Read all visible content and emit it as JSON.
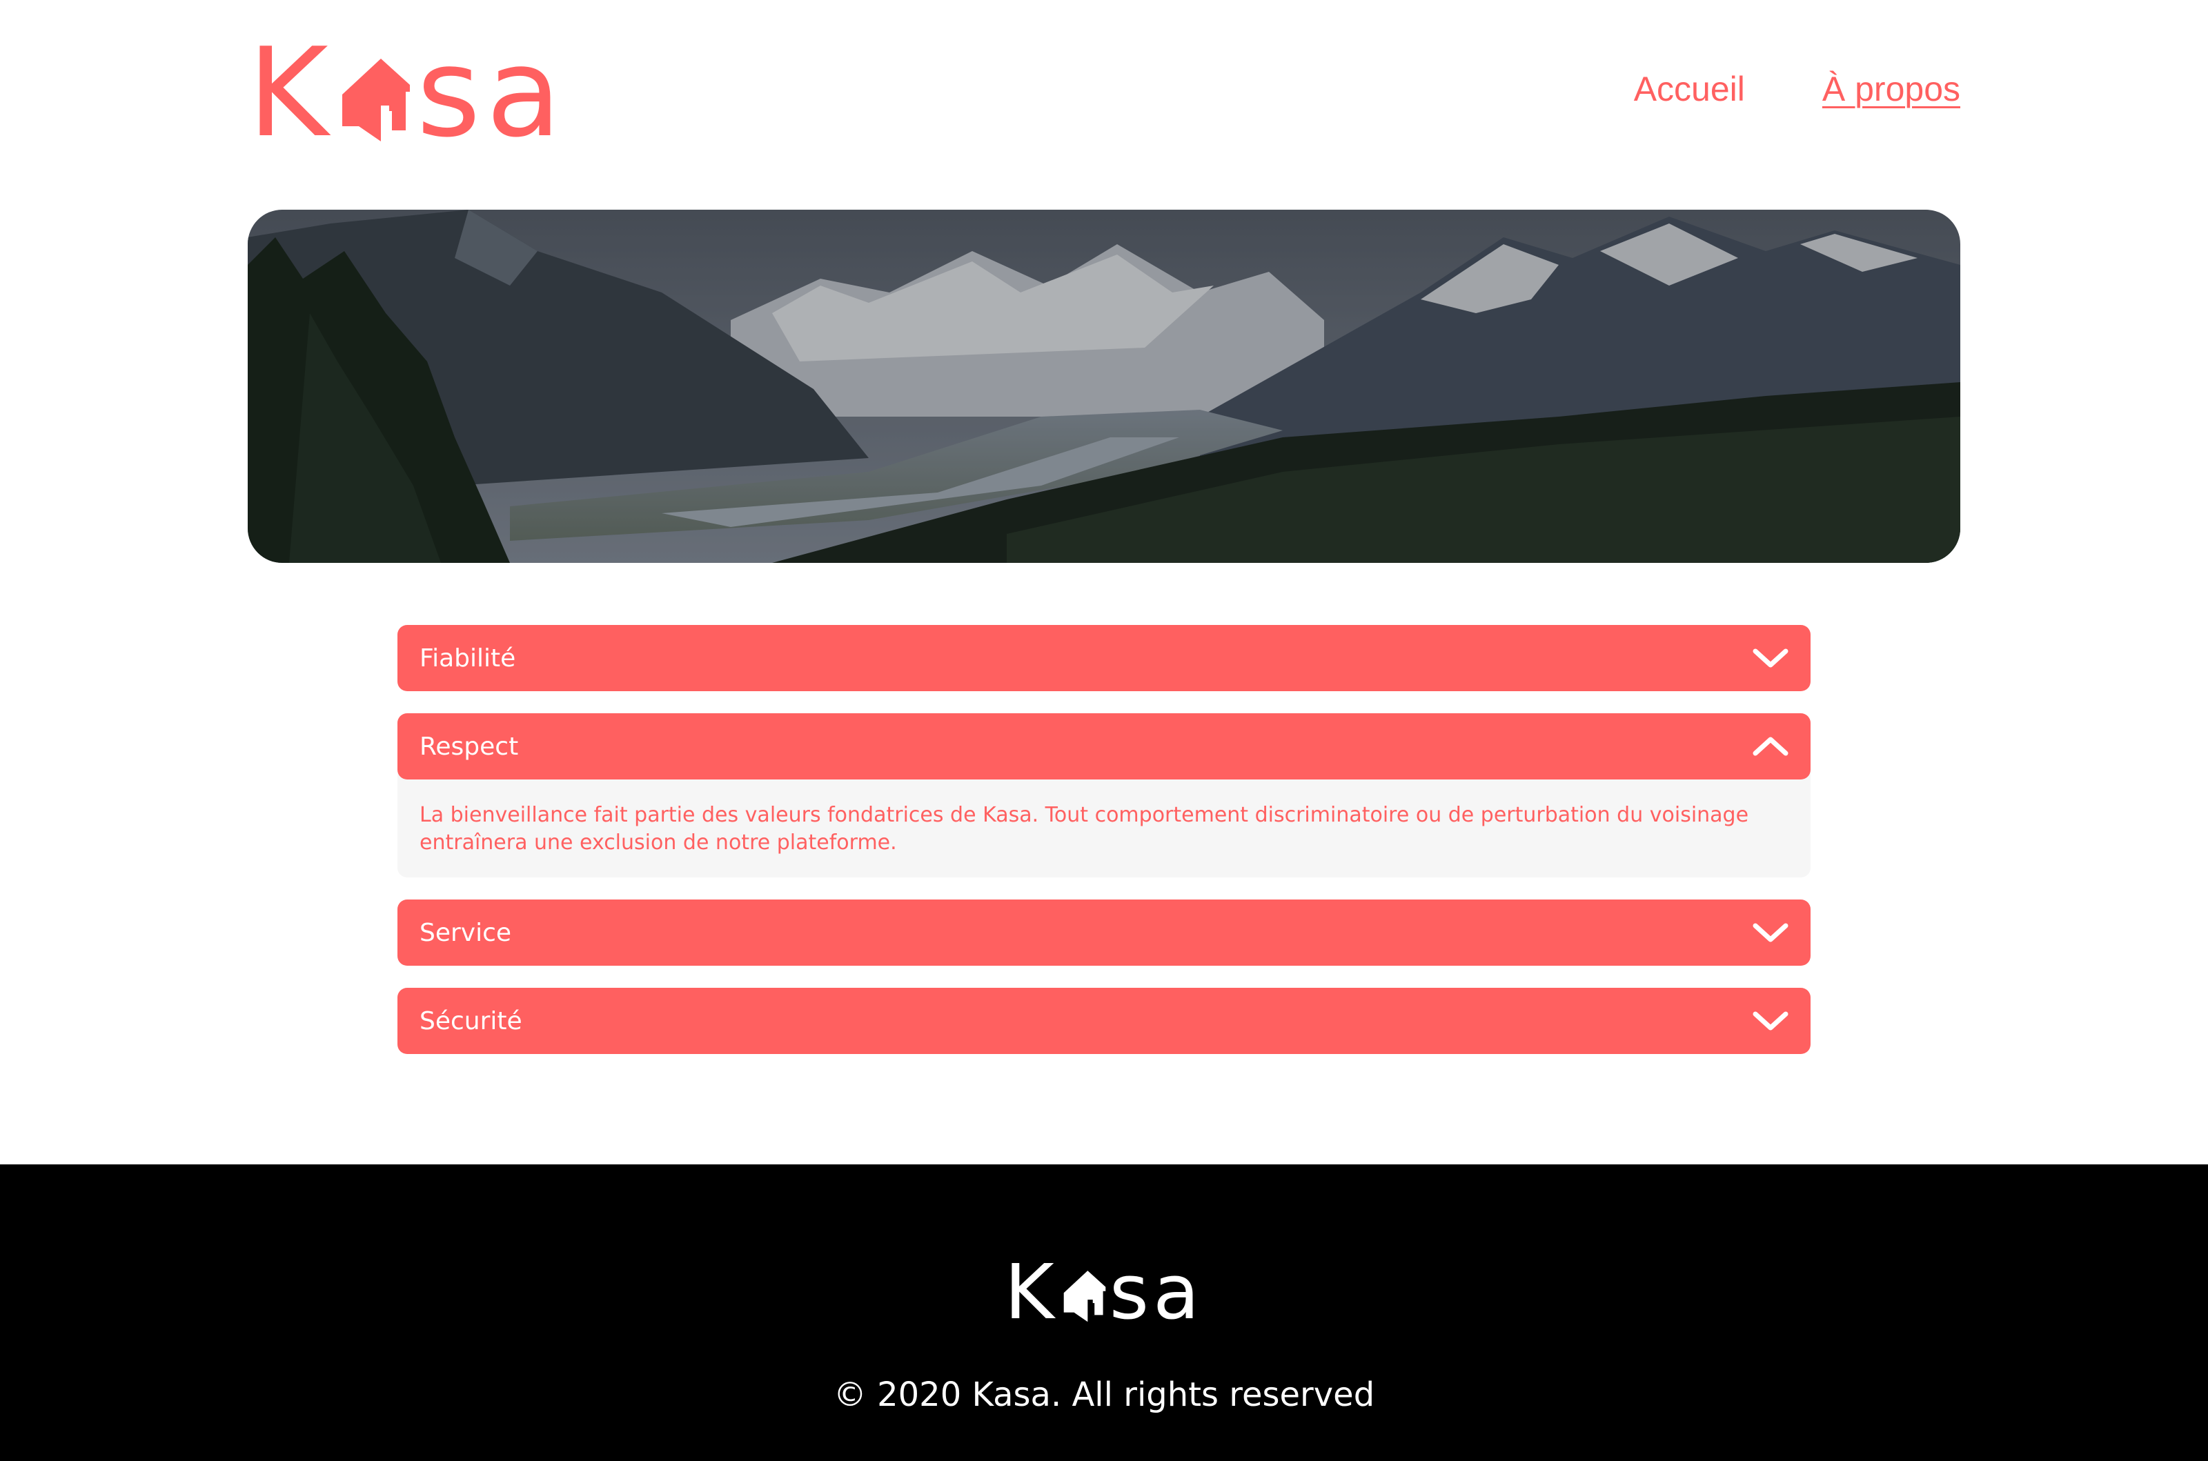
{
  "brand": {
    "name": "Kasa",
    "letters_before": "K",
    "letters_after": "sa",
    "accent_color": "#FF6060"
  },
  "nav": {
    "items": [
      {
        "label": "Accueil",
        "active": false
      },
      {
        "label": "À propos",
        "active": true
      }
    ]
  },
  "banner": {
    "icon": "mountain-landscape-image"
  },
  "accordion": {
    "items": [
      {
        "title": "Fiabilité",
        "expanded": false,
        "icon": "chevron-down-icon"
      },
      {
        "title": "Respect",
        "expanded": true,
        "icon": "chevron-up-icon",
        "content": "La bienveillance fait partie des valeurs fondatrices de Kasa. Tout comportement discriminatoire ou de perturbation du voisinage entraînera une exclusion de notre plateforme."
      },
      {
        "title": "Service",
        "expanded": false,
        "icon": "chevron-down-icon"
      },
      {
        "title": "Sécurité",
        "expanded": false,
        "icon": "chevron-down-icon"
      }
    ]
  },
  "footer": {
    "copyright": "© 2020 Kasa. All rights reserved",
    "background": "#000000"
  }
}
